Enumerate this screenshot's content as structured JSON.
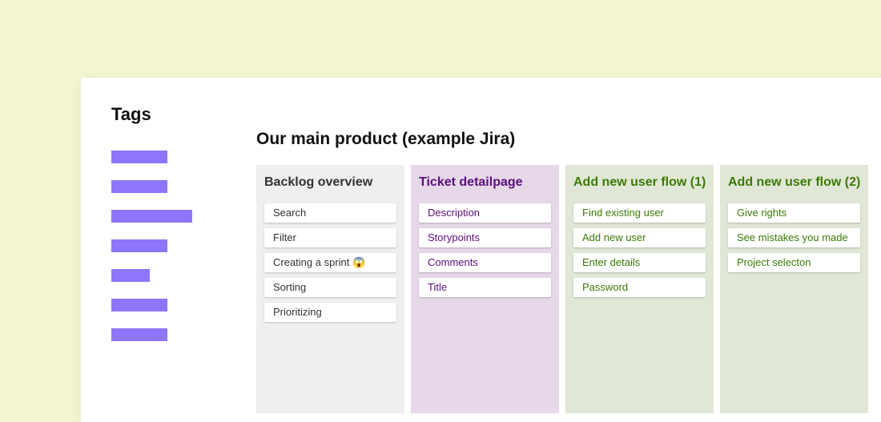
{
  "tags": {
    "title": "Tags"
  },
  "board": {
    "title": "Our main product (example Jira)",
    "columns": [
      {
        "title": "Backlog overview",
        "bg": "#efefef",
        "title_color": "#333333",
        "text_color": "#333333",
        "cards": [
          "Search",
          "Filter",
          "Creating a sprint 😱",
          "Sorting",
          "Prioritizing"
        ]
      },
      {
        "title": "Ticket detailpage",
        "bg": "#e6d8e8",
        "title_color": "#5a0f7a",
        "text_color": "#5a0f7a",
        "cards": [
          "Description",
          "Storypoints",
          "Comments",
          "Title"
        ]
      },
      {
        "title": "Add new user flow (1)",
        "bg": "#e1e7d6",
        "title_color": "#3c7a06",
        "text_color": "#3c7a06",
        "cards": [
          "Find existing user",
          "Add new user",
          "Enter details",
          "Password"
        ]
      },
      {
        "title": "Add new user flow (2)",
        "bg": "#e1e7d6",
        "title_color": "#3c7a06",
        "text_color": "#3c7a06",
        "cards": [
          "Give rights",
          "See mistakes you made",
          "Project selecton"
        ]
      }
    ]
  },
  "colors": {
    "page_bg": "#f5f5d1",
    "tag_bar": "#8f75fc"
  }
}
